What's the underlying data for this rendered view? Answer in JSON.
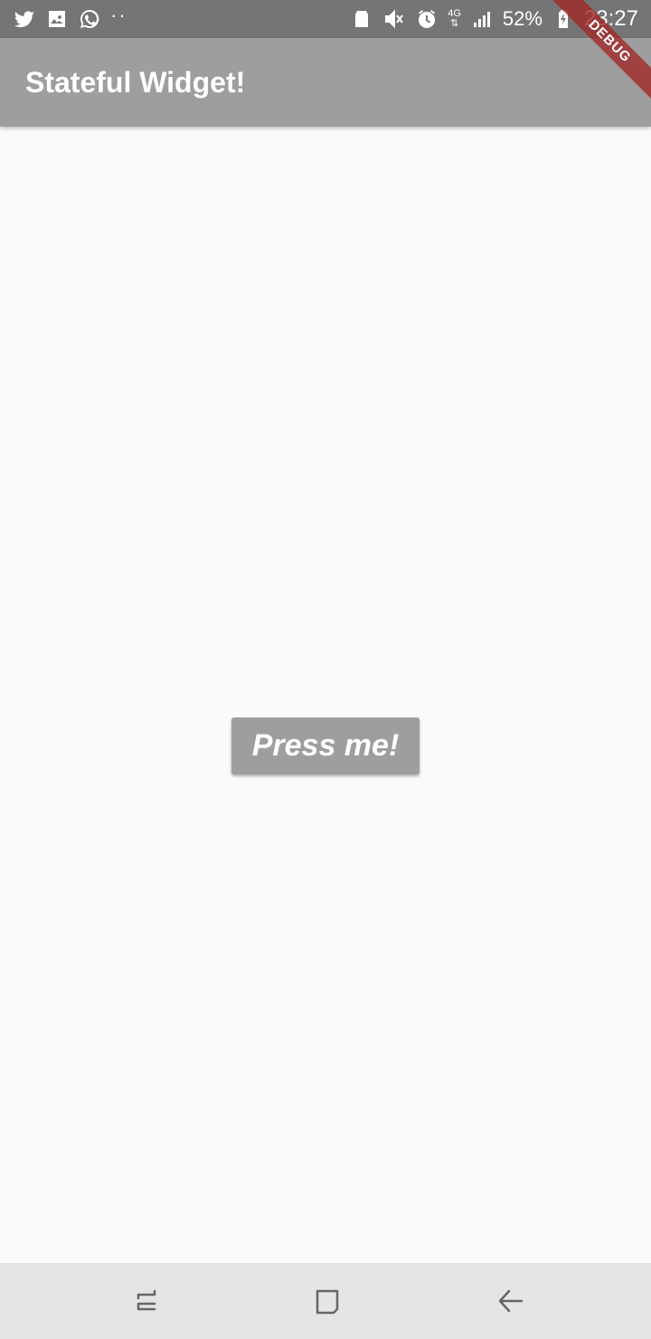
{
  "status_bar": {
    "icons_left": [
      "twitter-icon",
      "gallery-icon",
      "whatsapp-icon",
      "more-dots-icon"
    ],
    "icons_right": [
      "recycle-icon",
      "mute-icon",
      "alarm-icon",
      "network-icon",
      "signal-icon",
      "battery-icon"
    ],
    "network_label": "4G",
    "battery_percent": "52%",
    "time": "23:27"
  },
  "app_bar": {
    "title": "Stateful Widget!",
    "background_color": "#9e9e9e"
  },
  "debug_banner": {
    "label": "DEBUG",
    "color": "#a02828"
  },
  "main": {
    "button_label": "Press me!",
    "button_color": "#9e9e9e"
  },
  "nav_bar": {
    "icons": [
      "recent-apps-icon",
      "home-icon",
      "back-icon"
    ]
  }
}
